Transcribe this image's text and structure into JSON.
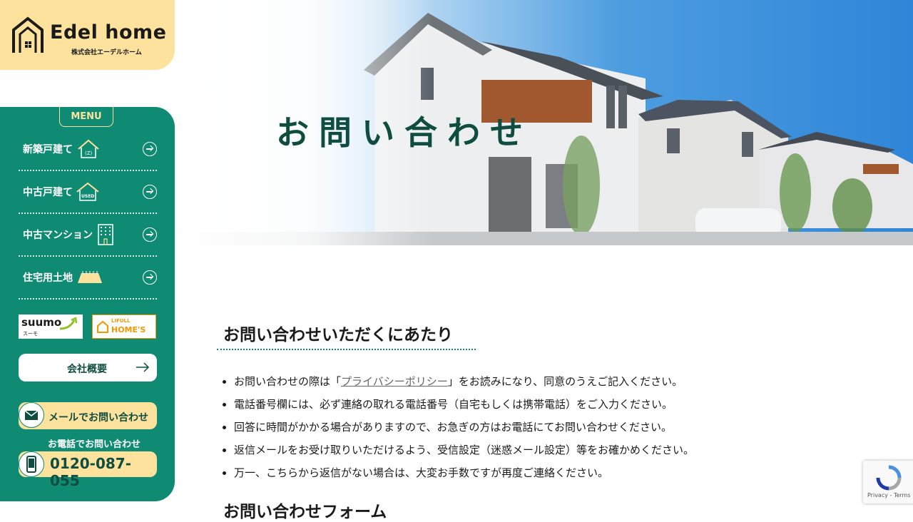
{
  "logo": {
    "brand": "Edel home",
    "company": "株式会社エーデルホーム"
  },
  "menu": {
    "tag": "MENU",
    "items": [
      {
        "label": "新築戸建て",
        "icon": "house-new-icon"
      },
      {
        "label": "中古戸建て",
        "icon": "house-used-icon"
      },
      {
        "label": "中古マンション",
        "icon": "building-icon"
      },
      {
        "label": "住宅用土地",
        "icon": "land-icon"
      }
    ]
  },
  "partners": {
    "suumo": "suumo",
    "suumo_sub": "スーモ",
    "homes_top": "LIFULL",
    "homes_bottom": "HOME'S"
  },
  "buttons": {
    "company": "会社概要",
    "mail": "メールでお問い合わせ",
    "phone_caption": "お電話でお問い合わせ",
    "phone_number": "0120-087-055"
  },
  "hero": {
    "title": "お問い合わせ"
  },
  "notice": {
    "title": "お問い合わせいただくにあたり",
    "items": {
      "0": {
        "before": "お問い合わせの際は「",
        "link": "プライバシーポリシー",
        "after": "」をお読みになり、同意のうえご記入ください。"
      },
      "1": "電話番号欄には、必ず連絡の取れる電話番号（自宅もしくは携帯電話）をご入力ください。",
      "2": "回答に時間がかかる場合がありますので、お急ぎの方はお電話にてお問い合わせください。",
      "3": "返信メールをお受け取りいただけるよう、受信設定（迷惑メール設定）等をお確かめください。",
      "4": "万一、こちらから返信がない場合は、大変お手数ですが再度ご連絡ください。"
    }
  },
  "form_section": {
    "title": "お問い合わせフォーム"
  },
  "recaptcha": {
    "text": "Privacy - Terms"
  },
  "colors": {
    "green": "#0f8a73",
    "dark_green": "#0f4d40",
    "yellow": "#fde29d"
  }
}
